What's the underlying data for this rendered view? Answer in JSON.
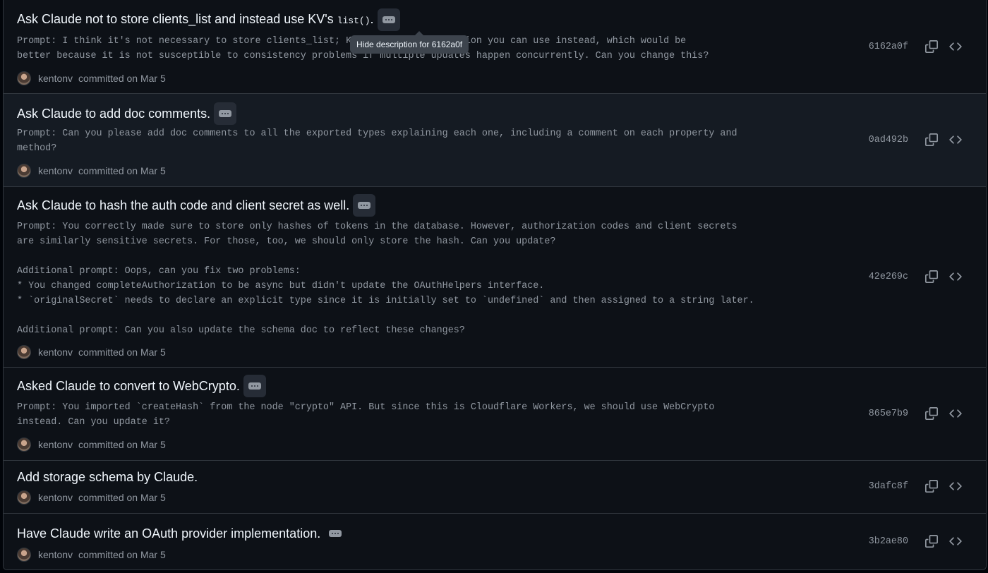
{
  "tooltip": "Hide description for 6162a0f",
  "commits": [
    {
      "title": "Ask Claude not to store clients_list and instead use KV's ",
      "title_code": "list()",
      "title_suffix": ".",
      "description": "Prompt: I think it's not necessary to store clients_list; KV has a list() function you can use instead, which would be\nbetter because it is not susceptible to consistency problems if multiple updates happen concurrently. Can you change this?",
      "author": "kentonv",
      "committed": "committed on Mar 5",
      "sha": "6162a0f"
    },
    {
      "title": "Ask Claude to add doc comments.",
      "description": "Prompt: Can you please add doc comments to all the exported types explaining each one, including a comment on each property and\nmethod?",
      "author": "kentonv",
      "committed": "committed on Mar 5",
      "sha": "0ad492b"
    },
    {
      "title": "Ask Claude to hash the auth code and client secret as well.",
      "description": "Prompt: You correctly made sure to store only hashes of tokens in the database. However, authorization codes and client secrets\nare similarly sensitive secrets. For those, too, we should only store the hash. Can you update?\n\nAdditional prompt: Oops, can you fix two problems:\n* You changed completeAuthorization to be async but didn't update the OAuthHelpers interface.\n* `originalSecret` needs to declare an explicit type since it is initially set to `undefined` and then assigned to a string later.\n\nAdditional prompt: Can you also update the schema doc to reflect these changes?",
      "author": "kentonv",
      "committed": "committed on Mar 5",
      "sha": "42e269c"
    },
    {
      "title": "Asked Claude to convert to WebCrypto.",
      "description": "Prompt: You imported `createHash` from the node \"crypto\" API. But since this is Cloudflare Workers, we should use WebCrypto\ninstead. Can you update it?",
      "author": "kentonv",
      "committed": "committed on Mar 5",
      "sha": "865e7b9"
    },
    {
      "title": "Add storage schema by Claude.",
      "author": "kentonv",
      "committed": "committed on Mar 5",
      "sha": "3dafc8f"
    },
    {
      "title": "Have Claude write an OAuth provider implementation.",
      "author": "kentonv",
      "committed": "committed on Mar 5",
      "sha": "3b2ae80"
    }
  ],
  "icons": {
    "expand": "ellipsis-icon",
    "copy": "copy-icon",
    "browse": "code-icon"
  }
}
